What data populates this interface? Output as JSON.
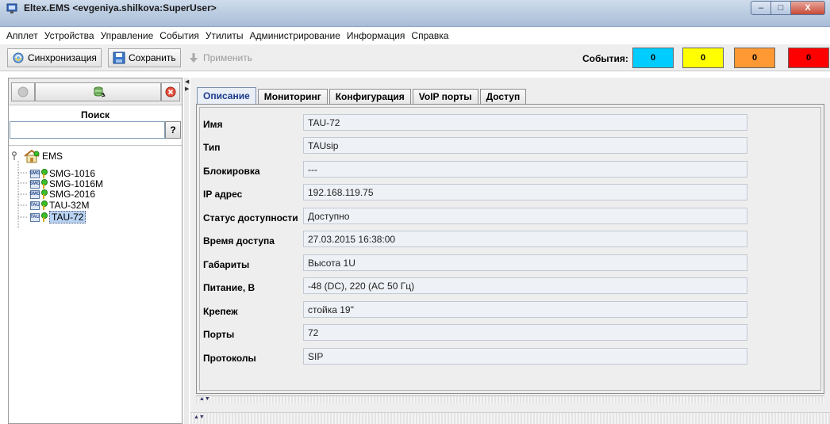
{
  "window": {
    "title": "Eltex.EMS <evgeniya.shilkova:SuperUser>",
    "controls": {
      "minimize": "–",
      "maximize": "□",
      "close": "X"
    }
  },
  "menu": [
    "Апплет",
    "Устройства",
    "Управление",
    "События",
    "Утилиты",
    "Администрирование",
    "Информация",
    "Справка"
  ],
  "toolbar": {
    "sync_label": "Синхронизация",
    "save_label": "Сохранить",
    "apply_label": "Применить",
    "events_label": "События:",
    "event_counters": [
      {
        "value": "0",
        "color": "#00ccff"
      },
      {
        "value": "0",
        "color": "#ffff00"
      },
      {
        "value": "0",
        "color": "#ff9933"
      },
      {
        "value": "0",
        "color": "#ff0000"
      }
    ]
  },
  "left_panel": {
    "search_label": "Поиск",
    "search_value": "",
    "search_help": "?",
    "tree": {
      "root": "EMS",
      "devices": [
        {
          "label": "SMG-1016",
          "icon": "SMG"
        },
        {
          "label": "SMG-1016M",
          "icon": "SMG"
        },
        {
          "label": "SMG-2016",
          "icon": "SMG"
        },
        {
          "label": "TAU-32M",
          "icon": "TAU"
        },
        {
          "label": "TAU-72",
          "icon": "TAU",
          "selected": true
        }
      ]
    }
  },
  "tabs": [
    {
      "label": "Описание",
      "active": true
    },
    {
      "label": "Мониторинг"
    },
    {
      "label": "Конфигурация"
    },
    {
      "label": "VoIP порты"
    },
    {
      "label": "Доступ"
    }
  ],
  "fields": [
    {
      "label": "Имя",
      "value": "TAU-72"
    },
    {
      "label": "Тип",
      "value": "TAUsip"
    },
    {
      "label": "Блокировка",
      "value": "---"
    },
    {
      "label": "IP адрес",
      "value": "192.168.119.75"
    },
    {
      "label": "Статус доступности",
      "value": "Доступно"
    },
    {
      "label": "Время доступа",
      "value": "27.03.2015 16:38:00"
    },
    {
      "label": "Габариты",
      "value": "Высота 1U"
    },
    {
      "label": "Питание, В",
      "value": "-48 (DC), 220 (AC 50 Гц)"
    },
    {
      "label": "Крепеж",
      "value": "стойка 19\""
    },
    {
      "label": "Порты",
      "value": "72"
    },
    {
      "label": "Протоколы",
      "value": "SIP"
    }
  ]
}
